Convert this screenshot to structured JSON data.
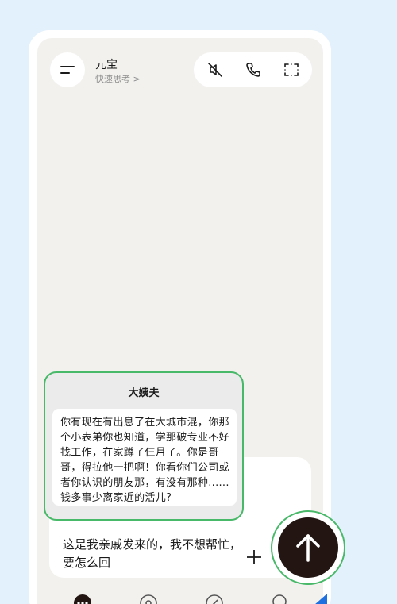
{
  "header": {
    "title": "元宝",
    "subtitle": "快速思考 >",
    "icons": [
      "menu-icon",
      "mute-icon",
      "phone-icon",
      "screenshot-icon"
    ]
  },
  "shared_card": {
    "title": "大姨夫",
    "message": "你有现在有出息了在大城市混，你那个小表弟你也知道，学那破专业不好找工作，在家蹲了仨月了。你是哥哥，得拉他一把啊！你看你们公司或者你认识的朋友那，有没有那种......钱多事少离家近的活儿?"
  },
  "composer": {
    "text": "这是我亲戚发来的，我不想帮忙，要怎么回",
    "icons": [
      "plus-icon",
      "send-icon"
    ]
  },
  "bottom_tabs": {
    "icons": [
      "chat-tab-icon",
      "discover-tab-icon",
      "create-tab-icon",
      "profile-tab-icon"
    ]
  },
  "colors": {
    "background": "#e3f1fc",
    "screen": "#f2f1ee",
    "highlight": "#48b869",
    "send_button": "#231612"
  }
}
